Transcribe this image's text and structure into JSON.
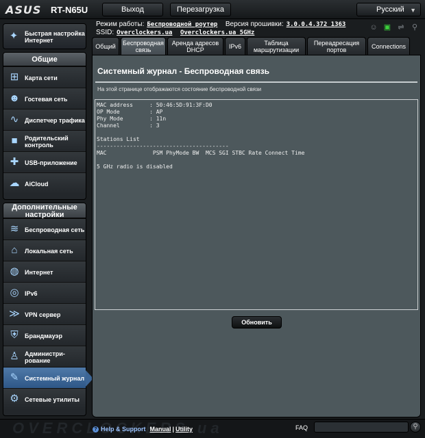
{
  "header": {
    "logo": "ASUS",
    "model": "RT-N65U",
    "logout_label": "Выход",
    "reboot_label": "Перезагрузка",
    "language": "Русский"
  },
  "status": {
    "mode_label": "Режим работы:",
    "mode_value": "Беспроводной роутер",
    "firmware_label": "Версия прошивки:",
    "firmware_value": "3.0.0.4.372_1363",
    "ssid_label": "SSID:",
    "ssid_1": "Overclockers.ua",
    "ssid_2": "Overclockers.ua_5GHz"
  },
  "sidebar": {
    "quick_setup": "Быстрая настройка Интернет",
    "general_title": "Общие",
    "general_items": [
      {
        "label": "Карта сети",
        "icon": "network-map-icon"
      },
      {
        "label": "Гостевая сеть",
        "icon": "guest-network-icon"
      },
      {
        "label": "Диспетчер трафика",
        "icon": "traffic-manager-icon"
      },
      {
        "label": "Родительский контроль",
        "icon": "parental-control-icon"
      },
      {
        "label": "USB-приложение",
        "icon": "usb-app-icon"
      },
      {
        "label": "AiCloud",
        "icon": "aicloud-icon"
      }
    ],
    "advanced_title": "Дополнительные настройки",
    "advanced_items": [
      {
        "label": "Беспроводная сеть",
        "icon": "wireless-icon"
      },
      {
        "label": "Локальная сеть",
        "icon": "lan-icon"
      },
      {
        "label": "Интернет",
        "icon": "wan-globe-icon"
      },
      {
        "label": "IPv6",
        "icon": "ipv6-icon"
      },
      {
        "label": "VPN сервер",
        "icon": "vpn-icon"
      },
      {
        "label": "Брандмауэр",
        "icon": "firewall-icon"
      },
      {
        "label": "Администри-рование",
        "icon": "admin-icon"
      },
      {
        "label": "Системный журнал",
        "icon": "system-log-icon"
      },
      {
        "label": "Сетевые утилиты",
        "icon": "network-tools-icon"
      }
    ]
  },
  "tabs": [
    "Общий",
    "Беспроводная связь",
    "Аренда адресов DHCP",
    "IPv6",
    "Таблица маршрутизации",
    "Переадресация портов",
    "Connections"
  ],
  "page": {
    "title": "Системный журнал - Беспроводная связь",
    "description": "На этой странице отображаются состояние беспроводной связи",
    "log_text": "MAC address     : 50:46:5D:91:3F:D0\nOP Mode         : AP\nPhy Mode        : 11n\nChannel         : 3\n\nStations List\n----------------------------------------\nMAC              PSM PhyMode BW  MCS SGI STBC Rate Connect Time\n\n5 GHz radio is disabled",
    "refresh_label": "Обновить"
  },
  "footer": {
    "watermark": "OVERCLOCKERS.ua",
    "help_label": "Help & Support",
    "manual_label": "Manual",
    "separator": "|",
    "utility_label": "Utility",
    "faq_label": "FAQ"
  }
}
